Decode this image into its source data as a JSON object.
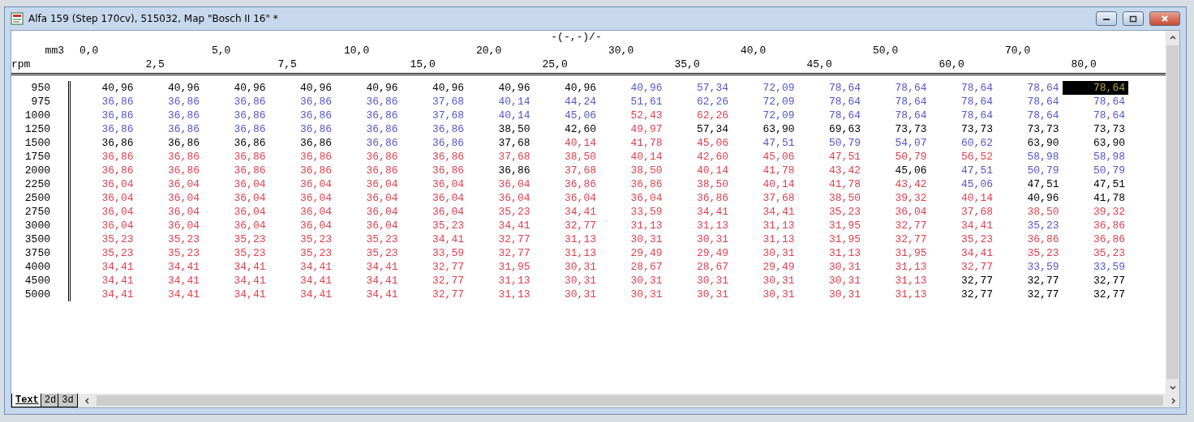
{
  "window": {
    "title": "Alfa 159 (Step 170cv), 515032, Map \"Bosch II 16\" *"
  },
  "map": {
    "title": "-(-,-)/-",
    "x_unit": "mm3",
    "y_unit": "rpm",
    "columns": [
      "0,0",
      "2,5",
      "5,0",
      "7,5",
      "10,0",
      "15,0",
      "20,0",
      "25,0",
      "30,0",
      "35,0",
      "40,0",
      "45,0",
      "50,0",
      "60,0",
      "70,0",
      "80,0"
    ],
    "rows": [
      {
        "rpm": "950",
        "cells": [
          {
            "value": "40,96",
            "color": "#000000",
            "selected": false
          },
          {
            "value": "40,96",
            "color": "#000000",
            "selected": false
          },
          {
            "value": "40,96",
            "color": "#000000",
            "selected": false
          },
          {
            "value": "40,96",
            "color": "#000000",
            "selected": false
          },
          {
            "value": "40,96",
            "color": "#000000",
            "selected": false
          },
          {
            "value": "40,96",
            "color": "#000000",
            "selected": false
          },
          {
            "value": "40,96",
            "color": "#000000",
            "selected": false
          },
          {
            "value": "40,96",
            "color": "#000000",
            "selected": false
          },
          {
            "value": "40,96",
            "color": "#5555cc",
            "selected": false
          },
          {
            "value": "57,34",
            "color": "#5555cc",
            "selected": false
          },
          {
            "value": "72,09",
            "color": "#5555cc",
            "selected": false
          },
          {
            "value": "78,64",
            "color": "#5555cc",
            "selected": false
          },
          {
            "value": "78,64",
            "color": "#5555cc",
            "selected": false
          },
          {
            "value": "78,64",
            "color": "#5555cc",
            "selected": false
          },
          {
            "value": "78,64",
            "color": "#5555cc",
            "selected": false
          },
          {
            "value": "78,64",
            "selected": true
          }
        ]
      },
      {
        "rpm": "975",
        "cells": [
          {
            "value": "36,86",
            "color": "#5555cc",
            "selected": false
          },
          {
            "value": "36,86",
            "color": "#5555cc",
            "selected": false
          },
          {
            "value": "36,86",
            "color": "#5555cc",
            "selected": false
          },
          {
            "value": "36,86",
            "color": "#5555cc",
            "selected": false
          },
          {
            "value": "36,86",
            "color": "#5555cc",
            "selected": false
          },
          {
            "value": "37,68",
            "color": "#5555cc",
            "selected": false
          },
          {
            "value": "40,14",
            "color": "#5555cc",
            "selected": false
          },
          {
            "value": "44,24",
            "color": "#5555cc",
            "selected": false
          },
          {
            "value": "51,61",
            "color": "#5555cc",
            "selected": false
          },
          {
            "value": "62,26",
            "color": "#5555cc",
            "selected": false
          },
          {
            "value": "72,09",
            "color": "#5555cc",
            "selected": false
          },
          {
            "value": "78,64",
            "color": "#5555cc",
            "selected": false
          },
          {
            "value": "78,64",
            "color": "#5555cc",
            "selected": false
          },
          {
            "value": "78,64",
            "color": "#5555cc",
            "selected": false
          },
          {
            "value": "78,64",
            "color": "#5555cc",
            "selected": false
          },
          {
            "value": "78,64",
            "color": "#5555cc",
            "selected": false
          }
        ]
      },
      {
        "rpm": "1000",
        "cells": [
          {
            "value": "36,86",
            "color": "#5555cc",
            "selected": false
          },
          {
            "value": "36,86",
            "color": "#5555cc",
            "selected": false
          },
          {
            "value": "36,86",
            "color": "#5555cc",
            "selected": false
          },
          {
            "value": "36,86",
            "color": "#5555cc",
            "selected": false
          },
          {
            "value": "36,86",
            "color": "#5555cc",
            "selected": false
          },
          {
            "value": "37,68",
            "color": "#5555cc",
            "selected": false
          },
          {
            "value": "40,14",
            "color": "#5555cc",
            "selected": false
          },
          {
            "value": "45,06",
            "color": "#5555cc",
            "selected": false
          },
          {
            "value": "52,43",
            "color": "#e0404f",
            "selected": false
          },
          {
            "value": "62,26",
            "color": "#e0404f",
            "selected": false
          },
          {
            "value": "72,09",
            "color": "#5555cc",
            "selected": false
          },
          {
            "value": "78,64",
            "color": "#5555cc",
            "selected": false
          },
          {
            "value": "78,64",
            "color": "#5555cc",
            "selected": false
          },
          {
            "value": "78,64",
            "color": "#5555cc",
            "selected": false
          },
          {
            "value": "78,64",
            "color": "#5555cc",
            "selected": false
          },
          {
            "value": "78,64",
            "color": "#5555cc",
            "selected": false
          }
        ]
      },
      {
        "rpm": "1250",
        "cells": [
          {
            "value": "36,86",
            "color": "#5555cc",
            "selected": false
          },
          {
            "value": "36,86",
            "color": "#5555cc",
            "selected": false
          },
          {
            "value": "36,86",
            "color": "#5555cc",
            "selected": false
          },
          {
            "value": "36,86",
            "color": "#5555cc",
            "selected": false
          },
          {
            "value": "36,86",
            "color": "#5555cc",
            "selected": false
          },
          {
            "value": "36,86",
            "color": "#5555cc",
            "selected": false
          },
          {
            "value": "38,50",
            "color": "#000000",
            "selected": false
          },
          {
            "value": "42,60",
            "color": "#000000",
            "selected": false
          },
          {
            "value": "49,97",
            "color": "#e0404f",
            "selected": false
          },
          {
            "value": "57,34",
            "color": "#000000",
            "selected": false
          },
          {
            "value": "63,90",
            "color": "#000000",
            "selected": false
          },
          {
            "value": "69,63",
            "color": "#000000",
            "selected": false
          },
          {
            "value": "73,73",
            "color": "#000000",
            "selected": false
          },
          {
            "value": "73,73",
            "color": "#000000",
            "selected": false
          },
          {
            "value": "73,73",
            "color": "#000000",
            "selected": false
          },
          {
            "value": "73,73",
            "color": "#000000",
            "selected": false
          }
        ]
      },
      {
        "rpm": "1500",
        "cells": [
          {
            "value": "36,86",
            "color": "#000000",
            "selected": false
          },
          {
            "value": "36,86",
            "color": "#000000",
            "selected": false
          },
          {
            "value": "36,86",
            "color": "#000000",
            "selected": false
          },
          {
            "value": "36,86",
            "color": "#000000",
            "selected": false
          },
          {
            "value": "36,86",
            "color": "#5555cc",
            "selected": false
          },
          {
            "value": "36,86",
            "color": "#5555cc",
            "selected": false
          },
          {
            "value": "37,68",
            "color": "#000000",
            "selected": false
          },
          {
            "value": "40,14",
            "color": "#e0404f",
            "selected": false
          },
          {
            "value": "41,78",
            "color": "#e0404f",
            "selected": false
          },
          {
            "value": "45,06",
            "color": "#e0404f",
            "selected": false
          },
          {
            "value": "47,51",
            "color": "#5555cc",
            "selected": false
          },
          {
            "value": "50,79",
            "color": "#5555cc",
            "selected": false
          },
          {
            "value": "54,07",
            "color": "#5555cc",
            "selected": false
          },
          {
            "value": "60,62",
            "color": "#5555cc",
            "selected": false
          },
          {
            "value": "63,90",
            "color": "#000000",
            "selected": false
          },
          {
            "value": "63,90",
            "color": "#000000",
            "selected": false
          }
        ]
      },
      {
        "rpm": "1750",
        "cells": [
          {
            "value": "36,86",
            "color": "#e0404f",
            "selected": false
          },
          {
            "value": "36,86",
            "color": "#e0404f",
            "selected": false
          },
          {
            "value": "36,86",
            "color": "#e0404f",
            "selected": false
          },
          {
            "value": "36,86",
            "color": "#e0404f",
            "selected": false
          },
          {
            "value": "36,86",
            "color": "#e0404f",
            "selected": false
          },
          {
            "value": "36,86",
            "color": "#e0404f",
            "selected": false
          },
          {
            "value": "37,68",
            "color": "#e0404f",
            "selected": false
          },
          {
            "value": "38,50",
            "color": "#e0404f",
            "selected": false
          },
          {
            "value": "40,14",
            "color": "#e0404f",
            "selected": false
          },
          {
            "value": "42,60",
            "color": "#e0404f",
            "selected": false
          },
          {
            "value": "45,06",
            "color": "#e0404f",
            "selected": false
          },
          {
            "value": "47,51",
            "color": "#e0404f",
            "selected": false
          },
          {
            "value": "50,79",
            "color": "#e0404f",
            "selected": false
          },
          {
            "value": "56,52",
            "color": "#e0404f",
            "selected": false
          },
          {
            "value": "58,98",
            "color": "#5555cc",
            "selected": false
          },
          {
            "value": "58,98",
            "color": "#5555cc",
            "selected": false
          }
        ]
      },
      {
        "rpm": "2000",
        "cells": [
          {
            "value": "36,86",
            "color": "#e0404f",
            "selected": false
          },
          {
            "value": "36,86",
            "color": "#e0404f",
            "selected": false
          },
          {
            "value": "36,86",
            "color": "#e0404f",
            "selected": false
          },
          {
            "value": "36,86",
            "color": "#e0404f",
            "selected": false
          },
          {
            "value": "36,86",
            "color": "#e0404f",
            "selected": false
          },
          {
            "value": "36,86",
            "color": "#e0404f",
            "selected": false
          },
          {
            "value": "36,86",
            "color": "#000000",
            "selected": false
          },
          {
            "value": "37,68",
            "color": "#e0404f",
            "selected": false
          },
          {
            "value": "38,50",
            "color": "#e0404f",
            "selected": false
          },
          {
            "value": "40,14",
            "color": "#e0404f",
            "selected": false
          },
          {
            "value": "41,78",
            "color": "#e0404f",
            "selected": false
          },
          {
            "value": "43,42",
            "color": "#e0404f",
            "selected": false
          },
          {
            "value": "45,06",
            "color": "#000000",
            "selected": false
          },
          {
            "value": "47,51",
            "color": "#5555cc",
            "selected": false
          },
          {
            "value": "50,79",
            "color": "#5555cc",
            "selected": false
          },
          {
            "value": "50,79",
            "color": "#5555cc",
            "selected": false
          }
        ]
      },
      {
        "rpm": "2250",
        "cells": [
          {
            "value": "36,04",
            "color": "#e0404f",
            "selected": false
          },
          {
            "value": "36,04",
            "color": "#e0404f",
            "selected": false
          },
          {
            "value": "36,04",
            "color": "#e0404f",
            "selected": false
          },
          {
            "value": "36,04",
            "color": "#e0404f",
            "selected": false
          },
          {
            "value": "36,04",
            "color": "#e0404f",
            "selected": false
          },
          {
            "value": "36,04",
            "color": "#e0404f",
            "selected": false
          },
          {
            "value": "36,04",
            "color": "#e0404f",
            "selected": false
          },
          {
            "value": "36,86",
            "color": "#e0404f",
            "selected": false
          },
          {
            "value": "36,86",
            "color": "#e0404f",
            "selected": false
          },
          {
            "value": "38,50",
            "color": "#e0404f",
            "selected": false
          },
          {
            "value": "40,14",
            "color": "#e0404f",
            "selected": false
          },
          {
            "value": "41,78",
            "color": "#e0404f",
            "selected": false
          },
          {
            "value": "43,42",
            "color": "#e0404f",
            "selected": false
          },
          {
            "value": "45,06",
            "color": "#5555cc",
            "selected": false
          },
          {
            "value": "47,51",
            "color": "#000000",
            "selected": false
          },
          {
            "value": "47,51",
            "color": "#000000",
            "selected": false
          }
        ]
      },
      {
        "rpm": "2500",
        "cells": [
          {
            "value": "36,04",
            "color": "#e0404f",
            "selected": false
          },
          {
            "value": "36,04",
            "color": "#e0404f",
            "selected": false
          },
          {
            "value": "36,04",
            "color": "#e0404f",
            "selected": false
          },
          {
            "value": "36,04",
            "color": "#e0404f",
            "selected": false
          },
          {
            "value": "36,04",
            "color": "#e0404f",
            "selected": false
          },
          {
            "value": "36,04",
            "color": "#e0404f",
            "selected": false
          },
          {
            "value": "36,04",
            "color": "#e0404f",
            "selected": false
          },
          {
            "value": "36,04",
            "color": "#e0404f",
            "selected": false
          },
          {
            "value": "36,04",
            "color": "#e0404f",
            "selected": false
          },
          {
            "value": "36,86",
            "color": "#e0404f",
            "selected": false
          },
          {
            "value": "37,68",
            "color": "#e0404f",
            "selected": false
          },
          {
            "value": "38,50",
            "color": "#e0404f",
            "selected": false
          },
          {
            "value": "39,32",
            "color": "#e0404f",
            "selected": false
          },
          {
            "value": "40,14",
            "color": "#e0404f",
            "selected": false
          },
          {
            "value": "40,96",
            "color": "#000000",
            "selected": false
          },
          {
            "value": "41,78",
            "color": "#000000",
            "selected": false
          }
        ]
      },
      {
        "rpm": "2750",
        "cells": [
          {
            "value": "36,04",
            "color": "#e0404f",
            "selected": false
          },
          {
            "value": "36,04",
            "color": "#e0404f",
            "selected": false
          },
          {
            "value": "36,04",
            "color": "#e0404f",
            "selected": false
          },
          {
            "value": "36,04",
            "color": "#e0404f",
            "selected": false
          },
          {
            "value": "36,04",
            "color": "#e0404f",
            "selected": false
          },
          {
            "value": "36,04",
            "color": "#e0404f",
            "selected": false
          },
          {
            "value": "35,23",
            "color": "#e0404f",
            "selected": false
          },
          {
            "value": "34,41",
            "color": "#e0404f",
            "selected": false
          },
          {
            "value": "33,59",
            "color": "#e0404f",
            "selected": false
          },
          {
            "value": "34,41",
            "color": "#e0404f",
            "selected": false
          },
          {
            "value": "34,41",
            "color": "#e0404f",
            "selected": false
          },
          {
            "value": "35,23",
            "color": "#e0404f",
            "selected": false
          },
          {
            "value": "36,04",
            "color": "#e0404f",
            "selected": false
          },
          {
            "value": "37,68",
            "color": "#e0404f",
            "selected": false
          },
          {
            "value": "38,50",
            "color": "#e0404f",
            "selected": false
          },
          {
            "value": "39,32",
            "color": "#e0404f",
            "selected": false
          }
        ]
      },
      {
        "rpm": "3000",
        "cells": [
          {
            "value": "36,04",
            "color": "#e0404f",
            "selected": false
          },
          {
            "value": "36,04",
            "color": "#e0404f",
            "selected": false
          },
          {
            "value": "36,04",
            "color": "#e0404f",
            "selected": false
          },
          {
            "value": "36,04",
            "color": "#e0404f",
            "selected": false
          },
          {
            "value": "36,04",
            "color": "#e0404f",
            "selected": false
          },
          {
            "value": "35,23",
            "color": "#e0404f",
            "selected": false
          },
          {
            "value": "34,41",
            "color": "#e0404f",
            "selected": false
          },
          {
            "value": "32,77",
            "color": "#e0404f",
            "selected": false
          },
          {
            "value": "31,13",
            "color": "#e0404f",
            "selected": false
          },
          {
            "value": "31,13",
            "color": "#e0404f",
            "selected": false
          },
          {
            "value": "31,13",
            "color": "#e0404f",
            "selected": false
          },
          {
            "value": "31,95",
            "color": "#e0404f",
            "selected": false
          },
          {
            "value": "32,77",
            "color": "#e0404f",
            "selected": false
          },
          {
            "value": "34,41",
            "color": "#e0404f",
            "selected": false
          },
          {
            "value": "35,23",
            "color": "#5555cc",
            "selected": false
          },
          {
            "value": "36,86",
            "color": "#e0404f",
            "selected": false
          }
        ]
      },
      {
        "rpm": "3500",
        "cells": [
          {
            "value": "35,23",
            "color": "#e0404f",
            "selected": false
          },
          {
            "value": "35,23",
            "color": "#e0404f",
            "selected": false
          },
          {
            "value": "35,23",
            "color": "#e0404f",
            "selected": false
          },
          {
            "value": "35,23",
            "color": "#e0404f",
            "selected": false
          },
          {
            "value": "35,23",
            "color": "#e0404f",
            "selected": false
          },
          {
            "value": "34,41",
            "color": "#e0404f",
            "selected": false
          },
          {
            "value": "32,77",
            "color": "#e0404f",
            "selected": false
          },
          {
            "value": "31,13",
            "color": "#e0404f",
            "selected": false
          },
          {
            "value": "30,31",
            "color": "#e0404f",
            "selected": false
          },
          {
            "value": "30,31",
            "color": "#e0404f",
            "selected": false
          },
          {
            "value": "31,13",
            "color": "#e0404f",
            "selected": false
          },
          {
            "value": "31,95",
            "color": "#e0404f",
            "selected": false
          },
          {
            "value": "32,77",
            "color": "#e0404f",
            "selected": false
          },
          {
            "value": "35,23",
            "color": "#e0404f",
            "selected": false
          },
          {
            "value": "36,86",
            "color": "#e0404f",
            "selected": false
          },
          {
            "value": "36,86",
            "color": "#e0404f",
            "selected": false
          }
        ]
      },
      {
        "rpm": "3750",
        "cells": [
          {
            "value": "35,23",
            "color": "#e0404f",
            "selected": false
          },
          {
            "value": "35,23",
            "color": "#e0404f",
            "selected": false
          },
          {
            "value": "35,23",
            "color": "#e0404f",
            "selected": false
          },
          {
            "value": "35,23",
            "color": "#e0404f",
            "selected": false
          },
          {
            "value": "35,23",
            "color": "#e0404f",
            "selected": false
          },
          {
            "value": "33,59",
            "color": "#e0404f",
            "selected": false
          },
          {
            "value": "32,77",
            "color": "#e0404f",
            "selected": false
          },
          {
            "value": "31,13",
            "color": "#e0404f",
            "selected": false
          },
          {
            "value": "29,49",
            "color": "#e0404f",
            "selected": false
          },
          {
            "value": "29,49",
            "color": "#e0404f",
            "selected": false
          },
          {
            "value": "30,31",
            "color": "#e0404f",
            "selected": false
          },
          {
            "value": "31,13",
            "color": "#e0404f",
            "selected": false
          },
          {
            "value": "31,95",
            "color": "#e0404f",
            "selected": false
          },
          {
            "value": "34,41",
            "color": "#e0404f",
            "selected": false
          },
          {
            "value": "35,23",
            "color": "#e0404f",
            "selected": false
          },
          {
            "value": "35,23",
            "color": "#e0404f",
            "selected": false
          }
        ]
      },
      {
        "rpm": "4000",
        "cells": [
          {
            "value": "34,41",
            "color": "#e0404f",
            "selected": false
          },
          {
            "value": "34,41",
            "color": "#e0404f",
            "selected": false
          },
          {
            "value": "34,41",
            "color": "#e0404f",
            "selected": false
          },
          {
            "value": "34,41",
            "color": "#e0404f",
            "selected": false
          },
          {
            "value": "34,41",
            "color": "#e0404f",
            "selected": false
          },
          {
            "value": "32,77",
            "color": "#e0404f",
            "selected": false
          },
          {
            "value": "31,95",
            "color": "#e0404f",
            "selected": false
          },
          {
            "value": "30,31",
            "color": "#e0404f",
            "selected": false
          },
          {
            "value": "28,67",
            "color": "#e0404f",
            "selected": false
          },
          {
            "value": "28,67",
            "color": "#e0404f",
            "selected": false
          },
          {
            "value": "29,49",
            "color": "#e0404f",
            "selected": false
          },
          {
            "value": "30,31",
            "color": "#e0404f",
            "selected": false
          },
          {
            "value": "31,13",
            "color": "#e0404f",
            "selected": false
          },
          {
            "value": "32,77",
            "color": "#e0404f",
            "selected": false
          },
          {
            "value": "33,59",
            "color": "#5555cc",
            "selected": false
          },
          {
            "value": "33,59",
            "color": "#5555cc",
            "selected": false
          }
        ]
      },
      {
        "rpm": "4500",
        "cells": [
          {
            "value": "34,41",
            "color": "#e0404f",
            "selected": false
          },
          {
            "value": "34,41",
            "color": "#e0404f",
            "selected": false
          },
          {
            "value": "34,41",
            "color": "#e0404f",
            "selected": false
          },
          {
            "value": "34,41",
            "color": "#e0404f",
            "selected": false
          },
          {
            "value": "34,41",
            "color": "#e0404f",
            "selected": false
          },
          {
            "value": "32,77",
            "color": "#e0404f",
            "selected": false
          },
          {
            "value": "31,13",
            "color": "#e0404f",
            "selected": false
          },
          {
            "value": "30,31",
            "color": "#e0404f",
            "selected": false
          },
          {
            "value": "30,31",
            "color": "#e0404f",
            "selected": false
          },
          {
            "value": "30,31",
            "color": "#e0404f",
            "selected": false
          },
          {
            "value": "30,31",
            "color": "#e0404f",
            "selected": false
          },
          {
            "value": "30,31",
            "color": "#e0404f",
            "selected": false
          },
          {
            "value": "31,13",
            "color": "#e0404f",
            "selected": false
          },
          {
            "value": "32,77",
            "color": "#000000",
            "selected": false
          },
          {
            "value": "32,77",
            "color": "#000000",
            "selected": false
          },
          {
            "value": "32,77",
            "color": "#000000",
            "selected": false
          }
        ]
      },
      {
        "rpm": "5000",
        "cells": [
          {
            "value": "34,41",
            "color": "#e0404f",
            "selected": false
          },
          {
            "value": "34,41",
            "color": "#e0404f",
            "selected": false
          },
          {
            "value": "34,41",
            "color": "#e0404f",
            "selected": false
          },
          {
            "value": "34,41",
            "color": "#e0404f",
            "selected": false
          },
          {
            "value": "34,41",
            "color": "#e0404f",
            "selected": false
          },
          {
            "value": "32,77",
            "color": "#e0404f",
            "selected": false
          },
          {
            "value": "31,13",
            "color": "#e0404f",
            "selected": false
          },
          {
            "value": "30,31",
            "color": "#e0404f",
            "selected": false
          },
          {
            "value": "30,31",
            "color": "#e0404f",
            "selected": false
          },
          {
            "value": "30,31",
            "color": "#e0404f",
            "selected": false
          },
          {
            "value": "30,31",
            "color": "#e0404f",
            "selected": false
          },
          {
            "value": "30,31",
            "color": "#e0404f",
            "selected": false
          },
          {
            "value": "31,13",
            "color": "#e0404f",
            "selected": false
          },
          {
            "value": "32,77",
            "color": "#000000",
            "selected": false
          },
          {
            "value": "32,77",
            "color": "#000000",
            "selected": false
          },
          {
            "value": "32,77",
            "color": "#000000",
            "selected": false
          }
        ]
      }
    ]
  },
  "view_tabs": [
    {
      "label": "Text",
      "selected": true
    },
    {
      "label": "2d",
      "selected": false
    },
    {
      "label": "3d",
      "selected": false
    }
  ]
}
